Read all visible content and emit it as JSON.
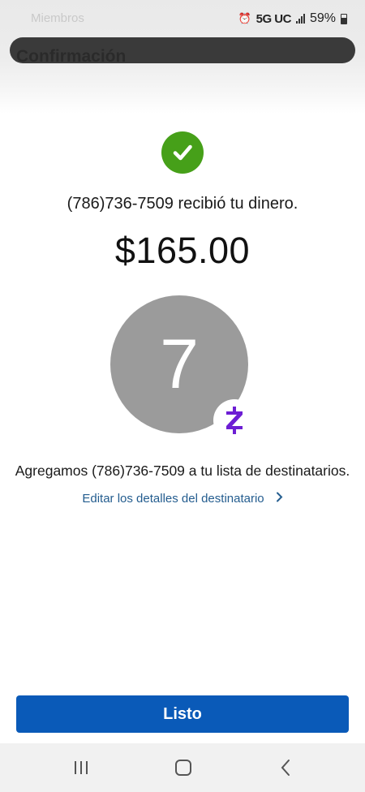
{
  "status_bar": {
    "ghost_text": "Miembros",
    "network": "5G UC",
    "battery": "59%"
  },
  "header": {
    "title": "Confirmación"
  },
  "confirmation": {
    "received_text": "(786)736-7509 recibió tu dinero.",
    "amount": "$165.00",
    "avatar_initial": "7",
    "added_text": "Agregamos (786)736-7509 a tu lista de destinatarios.",
    "edit_link": "Editar los detalles del destinatario",
    "success_color": "#46a019",
    "zelle_color": "#6d1ed4"
  },
  "footer": {
    "done_label": "Listo",
    "button_color": "#0a5ab8"
  },
  "nav": {
    "icons": [
      "recent-apps-icon",
      "home-icon",
      "back-icon"
    ]
  }
}
